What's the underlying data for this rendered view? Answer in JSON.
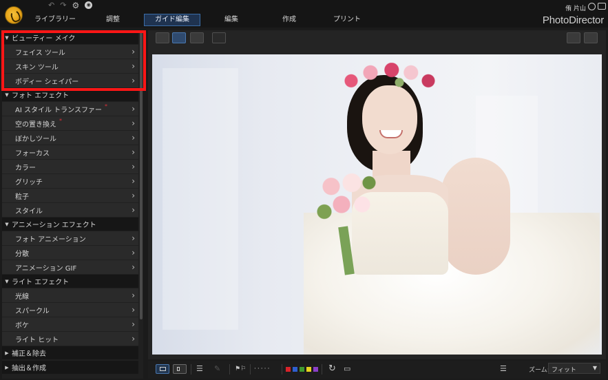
{
  "app": {
    "brand": "PhotoDirector",
    "user_name": "侑 片山"
  },
  "nav": {
    "tabs": [
      {
        "label": "ライブラリー",
        "active": false
      },
      {
        "label": "調整",
        "active": false
      },
      {
        "label": "ガイド編集",
        "active": true
      },
      {
        "label": "編集",
        "active": false
      },
      {
        "label": "作成",
        "active": false
      },
      {
        "label": "プリント",
        "active": false
      }
    ]
  },
  "sidebar": {
    "sections": [
      {
        "label": "ビューティー メイク",
        "expanded": true,
        "items": [
          "フェイス ツール",
          "スキン ツール",
          "ボディー シェイパー"
        ]
      },
      {
        "label": "フォト エフェクト",
        "expanded": true,
        "items": [
          "AI スタイル トランスファー",
          "空の置き換え",
          "ぼかしツール",
          "フォーカス",
          "カラー",
          "グリッチ",
          "粒子",
          "スタイル"
        ]
      },
      {
        "label": "アニメーション エフェクト",
        "expanded": true,
        "items": [
          "フォト アニメーション",
          "分散",
          "アニメーション GIF"
        ]
      },
      {
        "label": "ライト エフェクト",
        "expanded": true,
        "items": [
          "光線",
          "スパークル",
          "ボケ",
          "ライト ヒット"
        ]
      },
      {
        "label": "補正＆除去",
        "expanded": false,
        "items": []
      },
      {
        "label": "抽出＆作成",
        "expanded": false,
        "items": []
      }
    ],
    "new_badge_color": "#e0303a"
  },
  "toolbar": {
    "zoom_label": "ズーム:",
    "zoom_value": "フィット",
    "color_labels": [
      "#d8232a",
      "#2e5fcf",
      "#3f9a2f",
      "#e8d21f",
      "#8a3fc7"
    ]
  },
  "colors": {
    "accent": "#3b6ea8",
    "highlight_box": "#ff1616"
  }
}
